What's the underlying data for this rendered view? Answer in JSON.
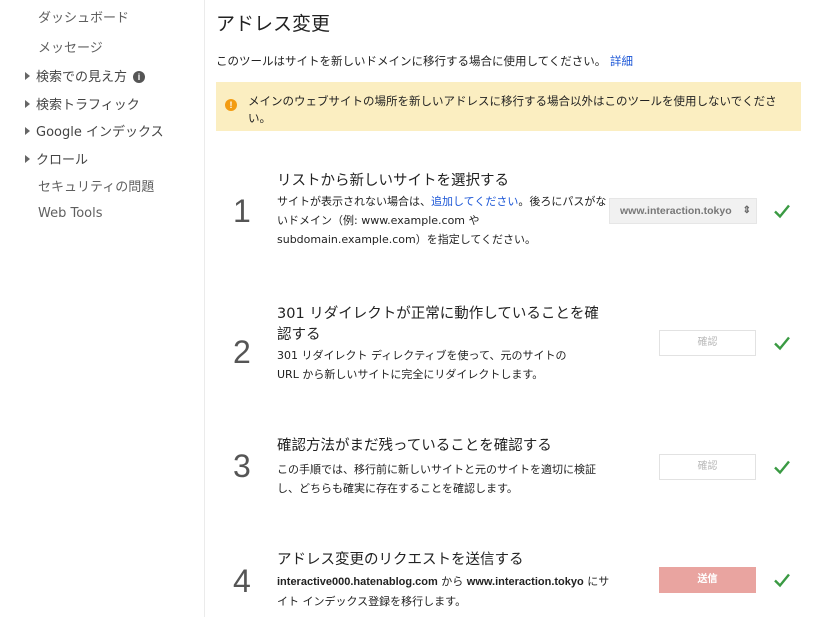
{
  "sidebar": {
    "items": [
      {
        "label": "ダッシュボード"
      },
      {
        "label": "メッセージ"
      },
      {
        "label": "検索での見え方"
      },
      {
        "label": "検索トラフィック"
      },
      {
        "label": "Google インデックス"
      },
      {
        "label": "クロール"
      },
      {
        "label": "セキュリティの問題"
      },
      {
        "label": "Web Tools"
      }
    ],
    "info_badge": "i"
  },
  "page": {
    "title": "アドレス変更",
    "intro": "このツールはサイトを新しいドメインに移行する場合に使用してください。",
    "intro_link": "詳細",
    "warning": "メインのウェブサイトの場所を新しいアドレスに移行する場合以外はこのツールを使用しないでください。",
    "warning_icon": "!"
  },
  "steps": [
    {
      "number": "1",
      "title": "リストから新しいサイトを選択する",
      "desc_pre": "サイトが表示されない場合は、",
      "desc_link": "追加してください",
      "desc_post": "。後ろにパスがないドメイン（例: www.example.com や subdomain.example.com）を指定してください。",
      "select_value": "www.interaction.tokyo",
      "select_arrows": "⇕"
    },
    {
      "number": "2",
      "title": "301 リダイレクトが正常に動作していることを確認する",
      "desc": "301 リダイレクト ディレクティブを使って、元のサイトの URL から新しいサイトに完全にリダイレクトします。",
      "button": "確認"
    },
    {
      "number": "3",
      "title": "確認方法がまだ残っていることを確認する",
      "desc": "この手順では、移行前に新しいサイトと元のサイトを適切に検証し、どちらも確実に存在することを確認します。",
      "button": "確認"
    },
    {
      "number": "4",
      "title": "アドレス変更のリクエストを送信する",
      "desc_from": "interactive000.hatenablog.com",
      "desc_mid": " から ",
      "desc_to": "www.interaction.tokyo",
      "desc_post": " にサイト インデックス登録を移行します。",
      "button": "送信"
    }
  ],
  "colors": {
    "check": "#3a9a43",
    "send": "#e9a4a0",
    "warning_bg": "#fbeec1",
    "link": "#1a55d6"
  }
}
